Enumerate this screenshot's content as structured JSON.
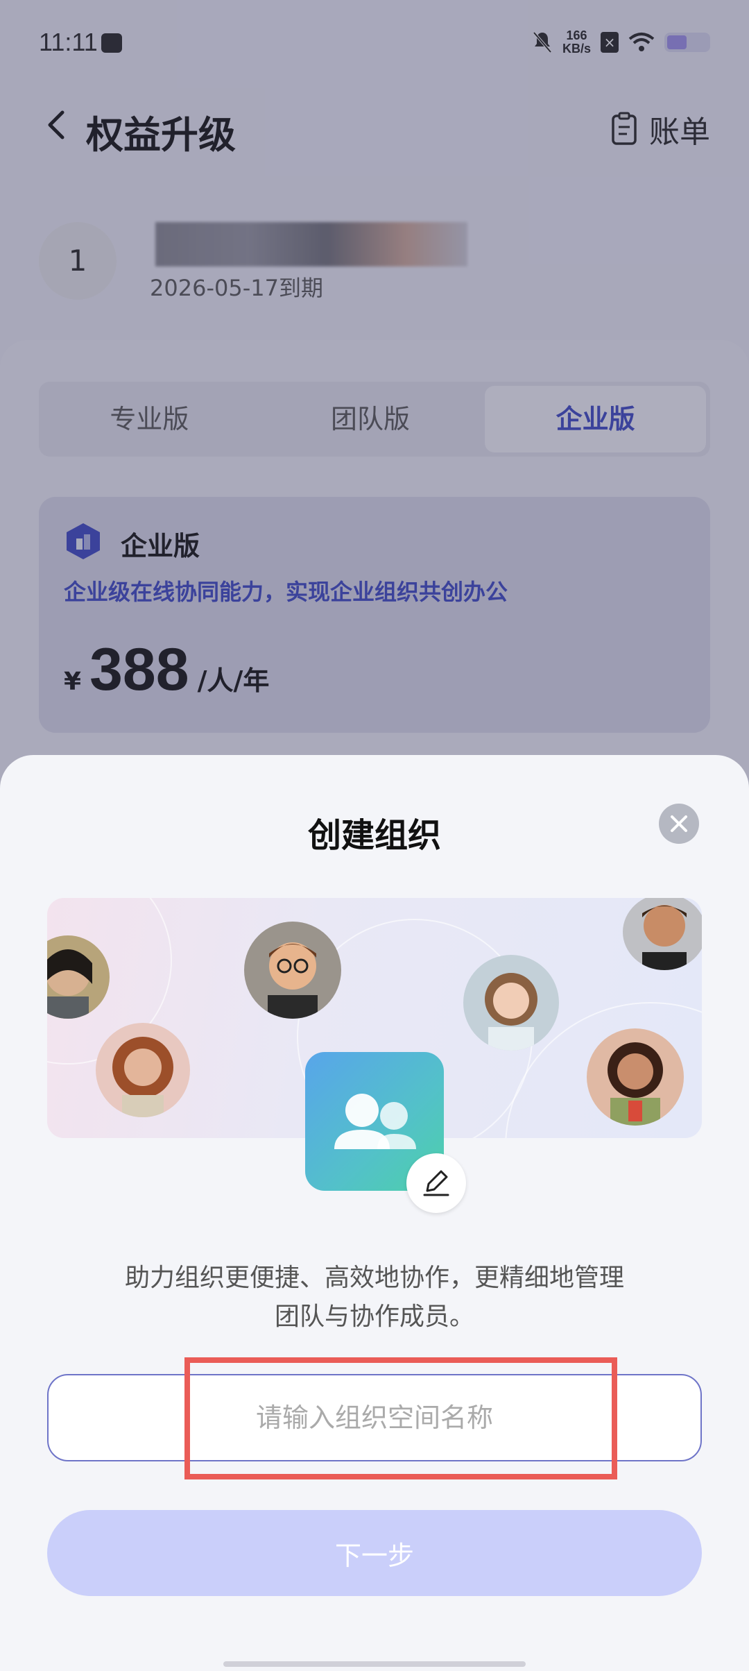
{
  "status_bar": {
    "time": "11:11",
    "net_speed_value": "166",
    "net_speed_unit": "KB/s"
  },
  "header": {
    "title": "权益升级",
    "bill_label": "账单"
  },
  "user": {
    "avatar_text": "1",
    "expiry": "2026-05-17到期"
  },
  "tabs": [
    {
      "label": "专业版",
      "active": false
    },
    {
      "label": "团队版",
      "active": false
    },
    {
      "label": "企业版",
      "active": true
    }
  ],
  "plan": {
    "name": "企业版",
    "description": "企业级在线协同能力，实现企业组织共创办公",
    "currency": "¥",
    "price": "388",
    "unit": "/人/年"
  },
  "sheet": {
    "title": "创建组织",
    "description_line1": "助力组织更便捷、高效地协作，更精细地管理",
    "description_line2": "团队与协作成员。",
    "input_placeholder": "请输入组织空间名称",
    "input_value": "",
    "next_label": "下一步"
  },
  "colors": {
    "accent": "#3b46c4",
    "button_disabled": "#cacffa",
    "highlight_box": "#ea5c57"
  },
  "icons": [
    "back-arrow-icon",
    "clipboard-icon",
    "close-icon",
    "team-icon",
    "pencil-icon",
    "enterprise-logo-icon",
    "wifi-icon",
    "battery-icon",
    "mute-bell-icon"
  ]
}
